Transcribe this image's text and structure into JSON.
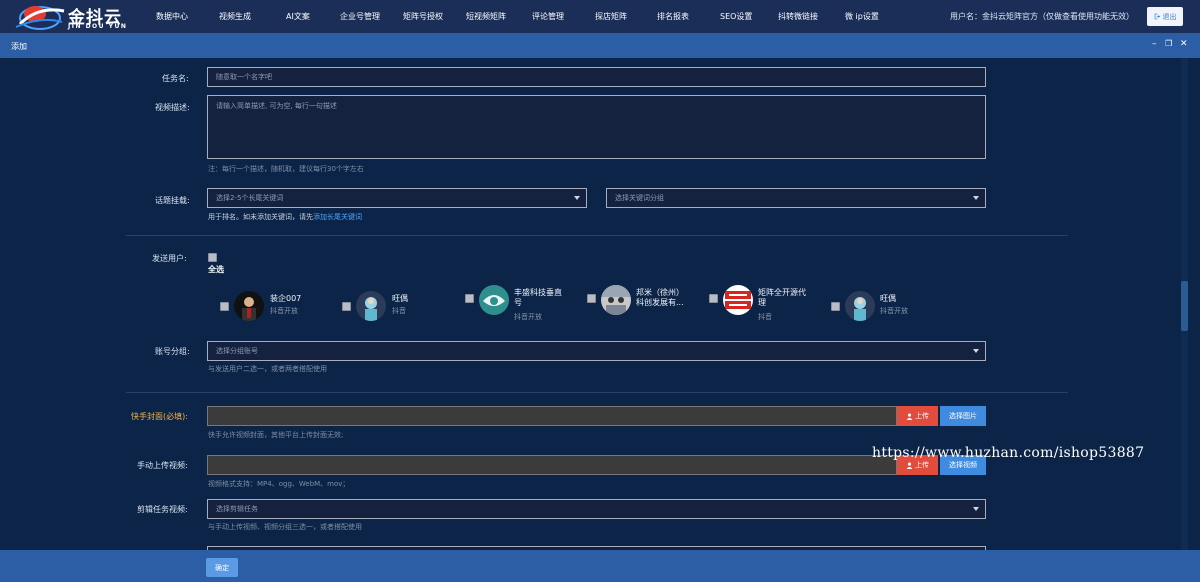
{
  "brand": {
    "name": "金抖云",
    "sub": "JIN DOU YUN"
  },
  "nav": [
    "数据中心",
    "视频生成",
    "AI文案",
    "企业号管理",
    "矩阵号授权",
    "短视频矩阵",
    "评论管理",
    "探店矩阵",
    "排名报表",
    "SEO设置",
    "抖转微链接",
    "微 ip设置"
  ],
  "user_text": "用户名：金抖云矩阵官方（仅做查看使用功能无效）",
  "logout": "退出",
  "dialog": {
    "title": "添加"
  },
  "form": {
    "task_name": {
      "label": "任务名:",
      "placeholder": "随意取一个名字吧"
    },
    "video_desc": {
      "label": "视频描述:",
      "placeholder": "请输入简单描述, 可为空, 每行一句描述",
      "hint": "注：每行一个描述，随机取，建议每行30个字左右"
    },
    "topic": {
      "label": "话题挂载:",
      "select1": "选择2-5个长尾关键词",
      "select2": "选择关键词分组",
      "hint_prefix": "用于排名。如未添加关键词，请先",
      "hint_link": "添加长尾关键词"
    },
    "send_users": {
      "label": "发送用户:",
      "select_all": "全选",
      "users": [
        {
          "name": "装企007",
          "sub": "抖音开放"
        },
        {
          "name": "旺偶",
          "sub": "抖音"
        },
        {
          "name": "丰盛科技垂直号",
          "sub": "抖音开放"
        },
        {
          "name": "邦米（徐州）科创发展有...",
          "sub": "抖音开放"
        },
        {
          "name": "矩阵全开源代理",
          "sub": "抖音"
        },
        {
          "name": "旺偶",
          "sub": "抖音开放"
        }
      ]
    },
    "account_group": {
      "label": "账号分组:",
      "select": "选择分组账号",
      "hint": "与发送用户二选一，或者两者搭配使用"
    },
    "kuaishou_cover": {
      "label": "快手封面(必填):",
      "upload": "上传",
      "choose": "选择图片",
      "hint": "快手允许视频封面，其他平台上传封面无效;"
    },
    "manual_upload": {
      "label": "手动上传视频:",
      "upload": "上传",
      "choose": "选择视频",
      "hint": "视频格式支持：MP4、ogg、WebM、mov；"
    },
    "edit_task": {
      "label": "剪辑任务视频:",
      "select": "选择剪辑任务",
      "hint": "与手动上传视频、视频分组三选一，或者搭配使用"
    }
  },
  "confirm": "确定",
  "watermark": "https://www.huzhan.com/ishop53887",
  "colors": {
    "accent": "#2b5ea5",
    "danger": "#e24c3c",
    "primary": "#3f8be0",
    "required": "#f0b34a"
  }
}
